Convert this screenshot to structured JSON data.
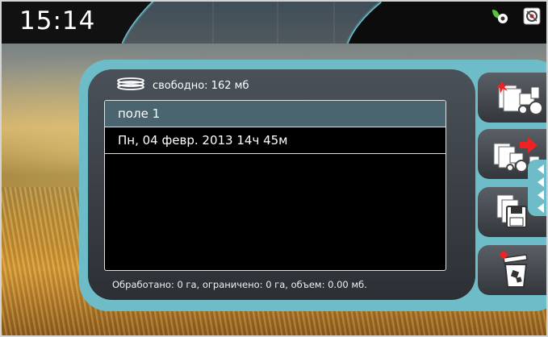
{
  "header": {
    "time": "15:14",
    "status_icons": [
      "tractor-leaf-icon",
      "signal-icon"
    ]
  },
  "storage": {
    "icon": "disk-stack-icon",
    "label": "свободно: 162 мб"
  },
  "list": {
    "rows": [
      {
        "label": "поле 1",
        "selected": true
      },
      {
        "label": "Пн, 04 февр. 2013 14ч 45м",
        "selected": false
      }
    ]
  },
  "footer": {
    "summary": "Обработано: 0 га, ограничено: 0 га, объем: 0.00 мб."
  },
  "sidebar": {
    "buttons": [
      {
        "name": "new-task-button",
        "icon": "new-document-tractor-icon"
      },
      {
        "name": "transfer-task-button",
        "icon": "document-transfer-tractor-icon"
      },
      {
        "name": "save-task-button",
        "icon": "document-floppy-icon"
      },
      {
        "name": "delete-task-button",
        "icon": "trash-icon"
      }
    ]
  },
  "colors": {
    "accent": "#6fbcc9",
    "selected_row": "#4a6470",
    "panel": "#3c4248"
  }
}
